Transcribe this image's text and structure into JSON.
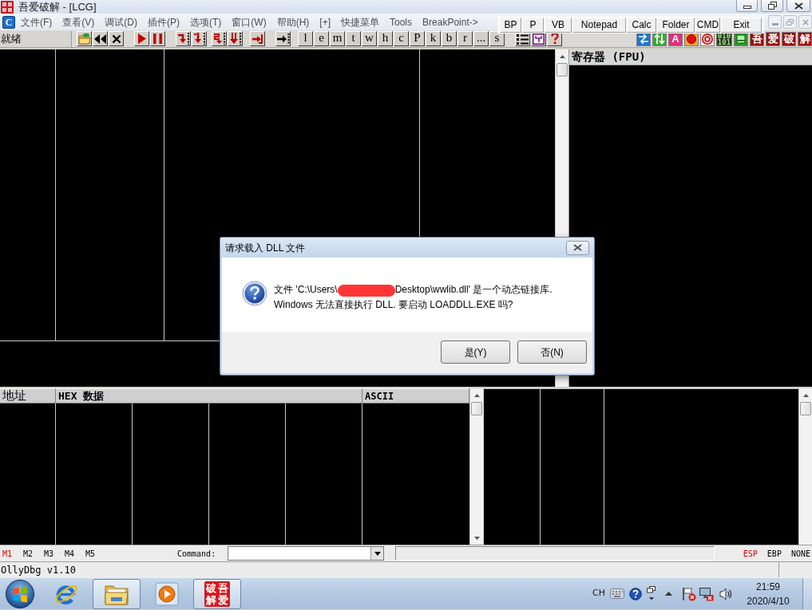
{
  "window": {
    "title": "吾爱破解 - [LCG]"
  },
  "menu_bar": {
    "window_icon_letter": "C",
    "items": [
      "文件(F)",
      "查看(V)",
      "调试(D)",
      "插件(P)",
      "选项(T)",
      "窗口(W)",
      "帮助(H)",
      "[+]",
      "快捷菜单",
      "Tools",
      "BreakPoint->"
    ]
  },
  "quick_launch": [
    "BP",
    "P",
    "VB",
    "Notepad",
    "Calc",
    "Folder",
    "CMD",
    "Exit"
  ],
  "toolbar": {
    "status": "就绪",
    "letter_buttons": [
      "l",
      "e",
      "m",
      "t",
      "w",
      "h",
      "c",
      "P",
      "k",
      "b",
      "r",
      "...",
      "s"
    ],
    "plugin_letter": "A",
    "plugin_binary": [
      "010",
      "101"
    ],
    "seal_buttons": [
      "吾",
      "爱",
      "破",
      "解"
    ]
  },
  "registers_pane": {
    "title": "寄存器 (FPU)"
  },
  "dump_pane": {
    "columns": [
      "地址",
      "HEX 数据",
      "ASCII"
    ]
  },
  "command_bar": {
    "memory_tabs": [
      {
        "label": "M1",
        "selected": true
      },
      {
        "label": "M2",
        "selected": false
      },
      {
        "label": "M3",
        "selected": false
      },
      {
        "label": "M4",
        "selected": false
      },
      {
        "label": "M5",
        "selected": false
      }
    ],
    "command_label": "Command:",
    "register_tabs": [
      {
        "label": "ESP",
        "selected": true
      },
      {
        "label": "EBP",
        "selected": false
      },
      {
        "label": "NONE",
        "selected": false
      }
    ]
  },
  "status_bar": {
    "text": "OllyDbg v1.10"
  },
  "dialog": {
    "title": "请求载入 DLL 文件",
    "message_lines": [
      [
        {
          "kind": "text",
          "text": "文件 'C:\\Users\\"
        },
        {
          "kind": "redaction"
        },
        {
          "kind": "text",
          "text": "Desktop\\wwlib.dll' 是一个动态链接库."
        }
      ],
      [
        {
          "kind": "text",
          "text": "Windows 无法直接执行 DLL. 要启动 LOADDLL.EXE 吗?"
        }
      ]
    ],
    "buttons": [
      "是(Y)",
      "否(N)"
    ]
  },
  "taskbar": {
    "apps": [
      {
        "kind": "browser",
        "running": false
      },
      {
        "kind": "folder",
        "running": true
      },
      {
        "kind": "media",
        "running": false
      },
      {
        "kind": "seal",
        "running": true,
        "characters": [
          "破",
          "吾",
          "解",
          "爱"
        ]
      }
    ],
    "tray": {
      "language": "CH",
      "time": "21:59",
      "date": "2020/4/10"
    }
  }
}
